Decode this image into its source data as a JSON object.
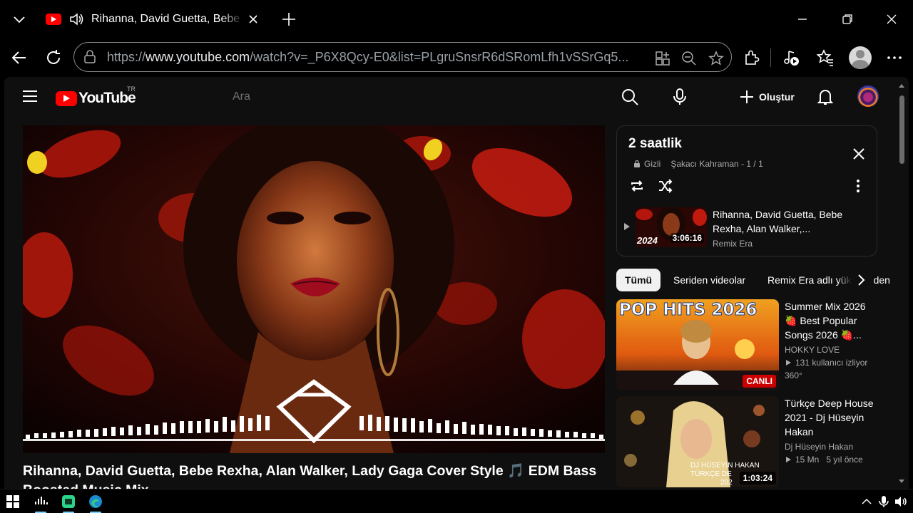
{
  "browser": {
    "tab_title": "Rihanna, David Guetta, Bebe Rexha, Alan Walker, Lady Gaga Cover Style",
    "url_prefix": "https://",
    "url_host": "www.youtube.com",
    "url_path": "/watch?v=_P6X8Qcy-E0&list=PLgruSnsrR6dSRomLfh1vSSrGq5..."
  },
  "youtube": {
    "logo_text": "YouTube",
    "country_code": "TR",
    "search_placeholder": "Ara",
    "create_label": "Oluştur"
  },
  "video": {
    "title": "Rihanna, David Guetta, Bebe Rexha, Alan Walker, Lady Gaga Cover Style 🎵 EDM Bass Boosted Music Mix"
  },
  "playlist": {
    "title": "2 saatlik",
    "privacy": "Gizli",
    "owner": "Şakacı Kahraman - 1 / 1",
    "item": {
      "title": "Rihanna, David Guetta, Bebe Rexha, Alan Walker,...",
      "channel": "Remix Era",
      "duration": "3:06:16",
      "thumb_text": "2024"
    }
  },
  "chips": [
    {
      "label": "Tümü",
      "active": true
    },
    {
      "label": "Seriden videolar",
      "active": false
    },
    {
      "label": "Remix Era adlı yükleyiciden",
      "active": false
    }
  ],
  "recommendations": [
    {
      "title": "Summer Mix 2026 🍓 Best Popular Songs 2026 🍓...",
      "channel": "HOKKY LOVE",
      "stat": "131 kullanıcı izliyor",
      "extra": "360°",
      "badge": "CANLI",
      "thumb_text": "POP HITS 2026"
    },
    {
      "title": "Türkçe Deep House 2021 - Dj Hüseyin Hakan",
      "channel": "Dj Hüseyin Hakan",
      "stat": "15 Mn",
      "age": "5 yıl önce",
      "badge": "1:03:24",
      "thumb_text": "DJ HÜSEYİN HAKAN",
      "thumb_text2": "TÜRKÇE DE",
      "thumb_text3": "202"
    }
  ],
  "colors": {
    "accent": "#ff0000",
    "live": "#cc0000",
    "bg": "#0f0f0f"
  }
}
